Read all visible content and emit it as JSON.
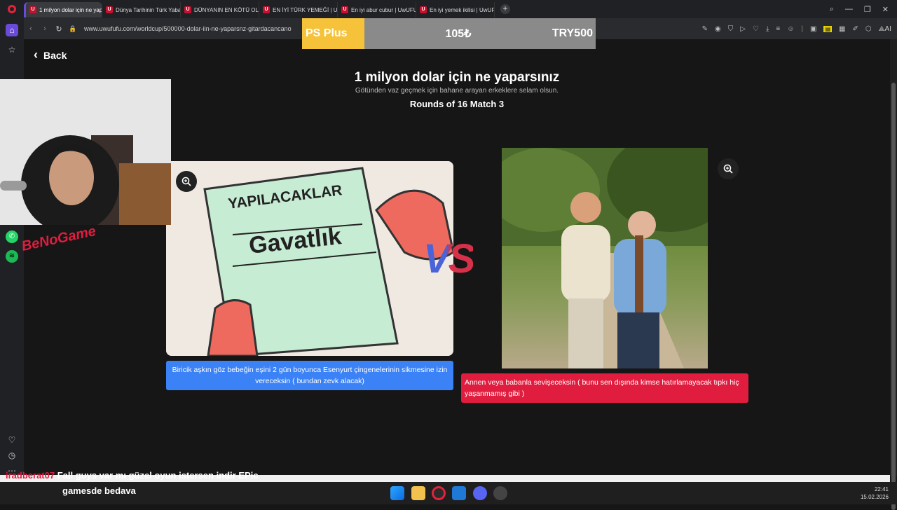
{
  "browser": {
    "tabs": [
      {
        "label": "1 milyon dolar için ne yap",
        "active": true
      },
      {
        "label": "Dünya Tarihinin Türk Yaba",
        "active": false
      },
      {
        "label": "DÜNYANIN EN KÖTÜ OLA",
        "active": false
      },
      {
        "label": "EN İYİ TÜRK YEMEĞİ | Uw",
        "active": false
      },
      {
        "label": "En iyi abur cubur | UwUFU",
        "active": false
      },
      {
        "label": "En iyi yemek ikilisi | UwUF",
        "active": false
      }
    ],
    "new_tab": "+",
    "url": "www.uwufufu.com/worldcup/500000-dolar-iin-ne-yaparsnz-gitardacancano",
    "ai_label": "AI"
  },
  "ad": {
    "brand": "PS Plus",
    "price": "105₺",
    "currency_price": "TRY500"
  },
  "page": {
    "back_label": "Back",
    "title": "1 milyon dolar için ne yaparsınız",
    "subtitle": "Götünden vaz geçmek için bahane arayan erkeklere selam olsun.",
    "round": "Rounds of 16 Match 3",
    "left_image_text_1": "YAPILACAKLAR",
    "left_image_text_2": "Gavatlık",
    "vs_label": "VS",
    "left_caption": "Biricik aşkın göz bebeğin eşini 2 gün boyunca Esenyurt çingenelerinin sikmesine izin vereceksin ( bundan zevk alacak)",
    "right_caption": "Annen veya babanla sevişeceksin ( bunu sen dışında kimse hatırlamayacak tıpkı hiç yaşanmamış gibi )"
  },
  "overlay": {
    "streamer_logo": "BeNoGame",
    "chat_user": "iradberat07",
    "chat_line_1": "Fall guys var mı güzel oyun istersen indir EPic",
    "chat_line_2": "gamesde bedava"
  },
  "taskbar": {
    "time": "22:41",
    "date": "15.02.2026"
  },
  "colors": {
    "blue_caption": "#3b82f6",
    "red_caption": "#e01d3f",
    "accent": "#e0243b"
  }
}
